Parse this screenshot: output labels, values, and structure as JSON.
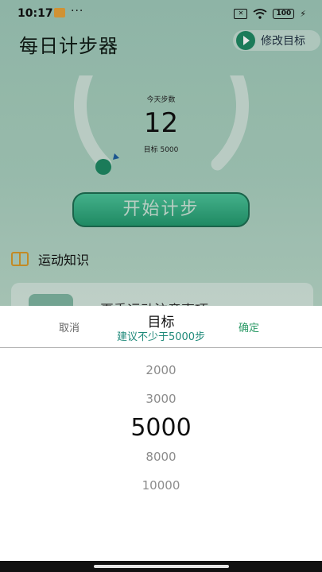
{
  "status_bar": {
    "time": "10:17",
    "dots": "···",
    "battery": "100"
  },
  "app": {
    "title": "每日计步器",
    "goal_button_label": "修改目标",
    "today_label": "今天步数",
    "steps": "12",
    "target_text": "目标 5000",
    "start_button_label": "开始计步",
    "knowledge_label": "运动知识",
    "article_title": "夏季运动注意事项"
  },
  "picker": {
    "cancel_label": "取消",
    "confirm_label": "确定",
    "title": "目标",
    "subtitle": "建议不少于5000步",
    "options": [
      "2000",
      "3000",
      "5000",
      "8000",
      "10000"
    ],
    "selected": "5000"
  },
  "colors": {
    "accent": "#2b9a66",
    "ring": "#cfe3da",
    "progress_dot": "#1f8a64",
    "subtitle": "#1f8a7a"
  }
}
